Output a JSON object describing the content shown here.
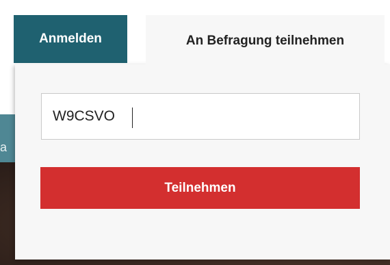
{
  "tabs": {
    "login_label": "Anmelden",
    "survey_label": "An Befragung teilnehmen"
  },
  "form": {
    "code_value": "W9CSVO",
    "submit_label": "Teilnehmen"
  },
  "background": {
    "band_fragment": "a"
  },
  "colors": {
    "login_tab": "#1f6170",
    "active_tab": "#f7f7f7",
    "submit_button": "#d32f2f",
    "teal_band": "#4f8794"
  }
}
